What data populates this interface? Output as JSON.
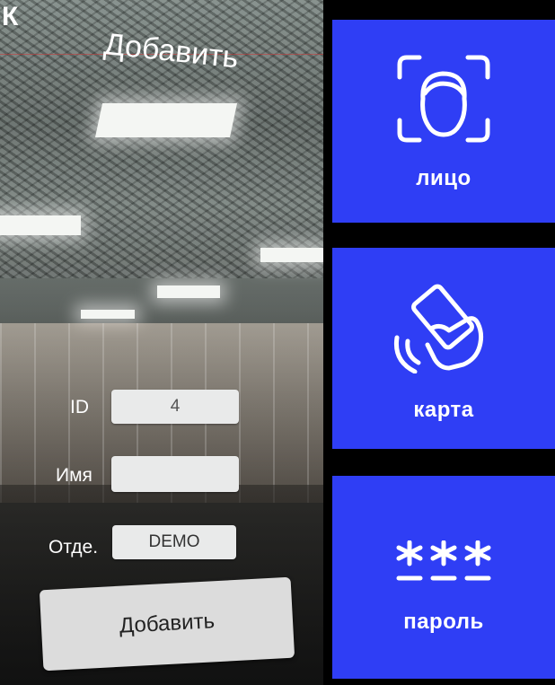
{
  "screen": {
    "title": "Добавить",
    "back_glyph": "К"
  },
  "form": {
    "id_label": "ID",
    "id_value": "4",
    "name_label": "Имя",
    "name_value": "",
    "dept_label": "Отде.",
    "dept_value": "DEMO",
    "submit_label": "Добавить"
  },
  "methods": [
    {
      "label": "лицо",
      "icon": "face-scan-icon"
    },
    {
      "label": "карта",
      "icon": "card-tap-icon"
    },
    {
      "label": "пароль",
      "icon": "password-icon"
    }
  ],
  "colors": {
    "tile": "#2f3ef5",
    "tile_text": "#ffffff"
  }
}
